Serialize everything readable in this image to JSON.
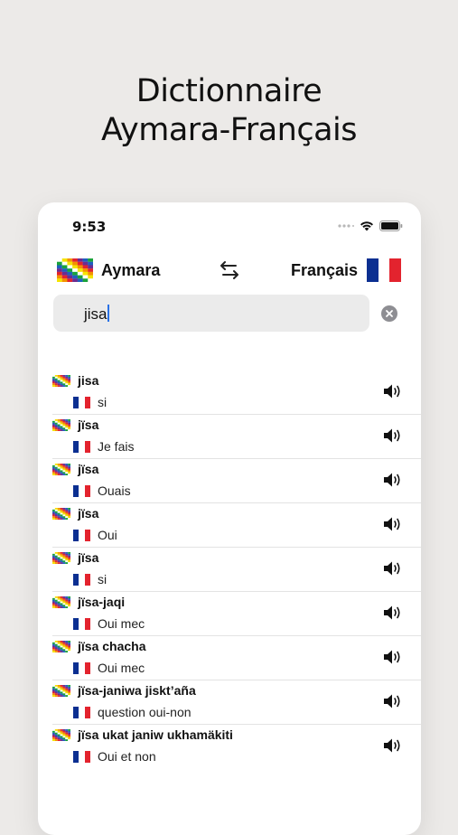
{
  "headline": {
    "line1": "Dictionnaire",
    "line2": "Aymara-Français"
  },
  "status_bar": {
    "time": "9:53"
  },
  "language_bar": {
    "source": "Aymara",
    "target": "Français"
  },
  "search": {
    "value": "jisa"
  },
  "colors": {
    "fr_blue": "#0b2f91",
    "fr_white": "#ffffff",
    "fr_red": "#e3232e",
    "caret": "#2a72e6"
  },
  "icons": {
    "swap": "swap-arrows-icon",
    "clear": "clear-circle-icon",
    "speaker": "speaker-icon",
    "wifi": "wifi-icon",
    "battery": "battery-icon"
  },
  "results": [
    {
      "aymara": "jisa",
      "french": "si"
    },
    {
      "aymara": "jïsa",
      "french": "Je fais"
    },
    {
      "aymara": "jïsa",
      "french": "Ouais"
    },
    {
      "aymara": "jïsa",
      "french": "Oui"
    },
    {
      "aymara": "jïsa",
      "french": "si"
    },
    {
      "aymara": "jïsa-jaqi",
      "french": "Oui mec"
    },
    {
      "aymara": "jïsa chacha",
      "french": "Oui mec"
    },
    {
      "aymara": "jïsa-janiwa jiskt’aña",
      "french": "question oui-non"
    },
    {
      "aymara": "jïsa ukat janiw ukhamäkiti",
      "french": "Oui et non"
    }
  ]
}
